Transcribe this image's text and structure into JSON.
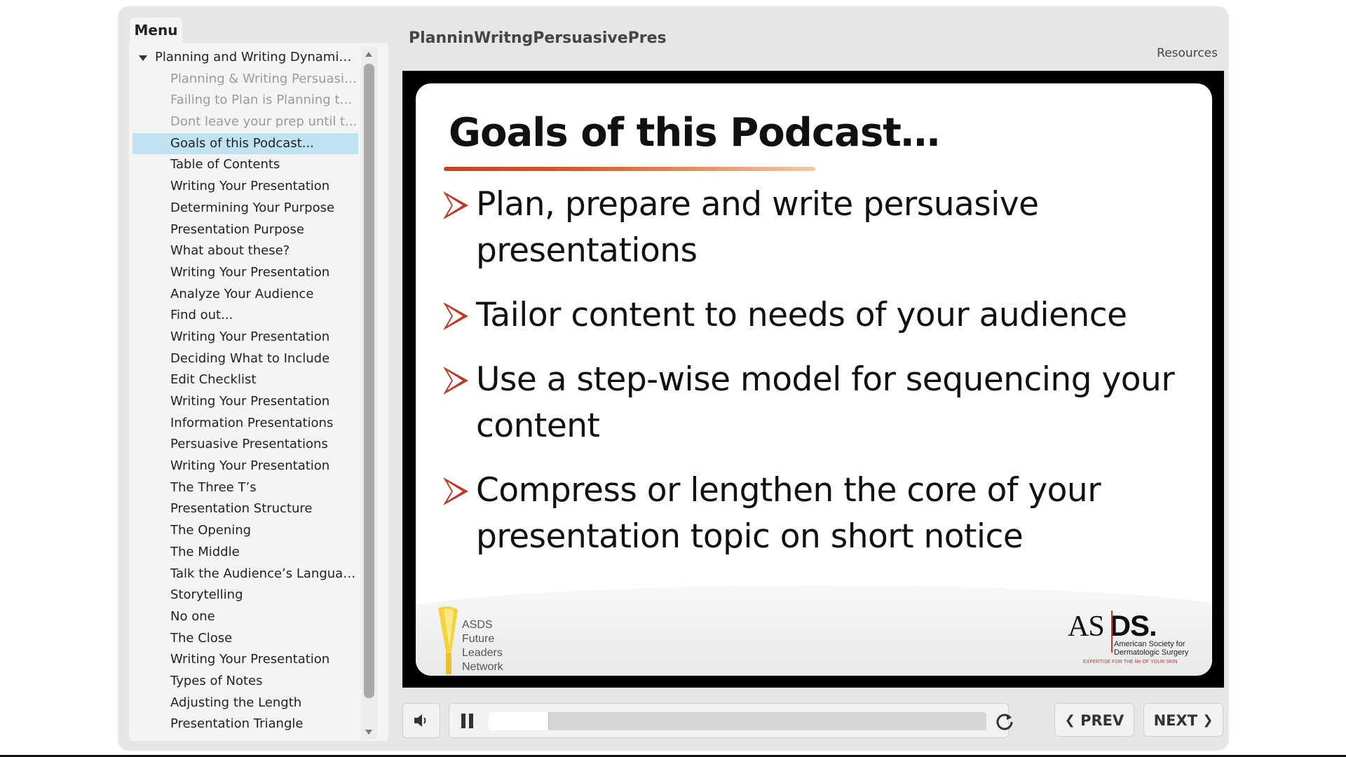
{
  "menu": {
    "tab_label": "Menu",
    "items": [
      {
        "label": "Planning and Writing Dynamic ...",
        "state": "root"
      },
      {
        "label": "Planning & Writing Persuasiv...",
        "state": "dim"
      },
      {
        "label": "Failing to Plan is Planning to ...",
        "state": "dim"
      },
      {
        "label": "Dont leave your prep until t...",
        "state": "dim"
      },
      {
        "label": "Goals of this Podcast...",
        "state": "active"
      },
      {
        "label": "Table of Contents",
        "state": "normal"
      },
      {
        "label": "Writing Your Presentation",
        "state": "normal"
      },
      {
        "label": "Determining Your Purpose",
        "state": "normal"
      },
      {
        "label": "Presentation Purpose",
        "state": "normal"
      },
      {
        "label": "What about these?",
        "state": "normal"
      },
      {
        "label": "Writing Your Presentation",
        "state": "normal"
      },
      {
        "label": "Analyze Your Audience",
        "state": "normal"
      },
      {
        "label": "Find out...",
        "state": "normal"
      },
      {
        "label": "Writing Your Presentation",
        "state": "normal"
      },
      {
        "label": "Deciding What to Include",
        "state": "normal"
      },
      {
        "label": "Edit Checklist",
        "state": "normal"
      },
      {
        "label": "Writing Your Presentation",
        "state": "normal"
      },
      {
        "label": "Information Presentations",
        "state": "normal"
      },
      {
        "label": "Persuasive Presentations",
        "state": "normal"
      },
      {
        "label": "Writing Your Presentation",
        "state": "normal"
      },
      {
        "label": "The Three T’s",
        "state": "normal"
      },
      {
        "label": "Presentation Structure",
        "state": "normal"
      },
      {
        "label": "The Opening",
        "state": "normal"
      },
      {
        "label": "The Middle",
        "state": "normal"
      },
      {
        "label": "Talk the Audience’s Language",
        "state": "normal"
      },
      {
        "label": "Storytelling",
        "state": "normal"
      },
      {
        "label": "No one",
        "state": "normal"
      },
      {
        "label": "The Close",
        "state": "normal"
      },
      {
        "label": "Writing Your Presentation",
        "state": "normal"
      },
      {
        "label": "Types of Notes",
        "state": "normal"
      },
      {
        "label": "Adjusting the Length",
        "state": "normal"
      },
      {
        "label": "Presentation Triangle",
        "state": "normal"
      }
    ]
  },
  "header": {
    "title": "PlanninWritngPersuasivePres",
    "resources_label": "Resources"
  },
  "slide": {
    "heading": "Goals of this Podcast…",
    "bullets": [
      "Plan, prepare and write persuasive presentations",
      "Tailor content to needs of your audience",
      "Use a step-wise model for sequencing your content",
      "Compress or lengthen the core of your presentation topic on short notice"
    ],
    "logo_left_lines": [
      "ASDS",
      "Future",
      "Leaders",
      "Network"
    ],
    "logo_right": {
      "mark_left": "AS",
      "mark_right": "DS.",
      "name_line1": "American Society for",
      "name_line2": "Dermatologic Surgery",
      "tagline": "EXPERTISE FOR THE life OF YOUR SKIN"
    }
  },
  "controls": {
    "progress_fraction": 0.12,
    "prev_label": "PREV",
    "next_label": "NEXT"
  },
  "colors": {
    "active_item": "#bfe3f2",
    "bullet_arrow": "#c0392b"
  }
}
